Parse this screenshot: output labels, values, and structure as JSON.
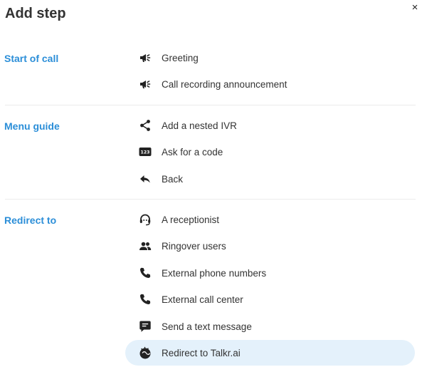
{
  "dialog": {
    "title": "Add step",
    "close_label": "×"
  },
  "colors": {
    "accent": "#2b8ed8",
    "selected_bg": "#e4f1fb",
    "divider": "#ebebeb"
  },
  "sections": [
    {
      "title": "Start of call",
      "items": [
        {
          "label": "Greeting",
          "icon": "megaphone-icon"
        },
        {
          "label": "Call recording announcement",
          "icon": "megaphone-icon"
        }
      ]
    },
    {
      "title": "Menu guide",
      "items": [
        {
          "label": "Add a nested IVR",
          "icon": "share-icon"
        },
        {
          "label": "Ask for a code",
          "icon": "keypad-123-icon",
          "icon_text": "123"
        },
        {
          "label": "Back",
          "icon": "reply-arrow-icon"
        }
      ]
    },
    {
      "title": "Redirect to",
      "items": [
        {
          "label": "A receptionist",
          "icon": "headset-icon"
        },
        {
          "label": "Ringover users",
          "icon": "users-icon"
        },
        {
          "label": "External phone numbers",
          "icon": "phone-icon"
        },
        {
          "label": "External call center",
          "icon": "phone-icon"
        },
        {
          "label": "Send a text message",
          "icon": "message-icon"
        },
        {
          "label": "Redirect to Talkr.ai",
          "icon": "talkr-ai-icon",
          "selected": true
        }
      ]
    }
  ]
}
